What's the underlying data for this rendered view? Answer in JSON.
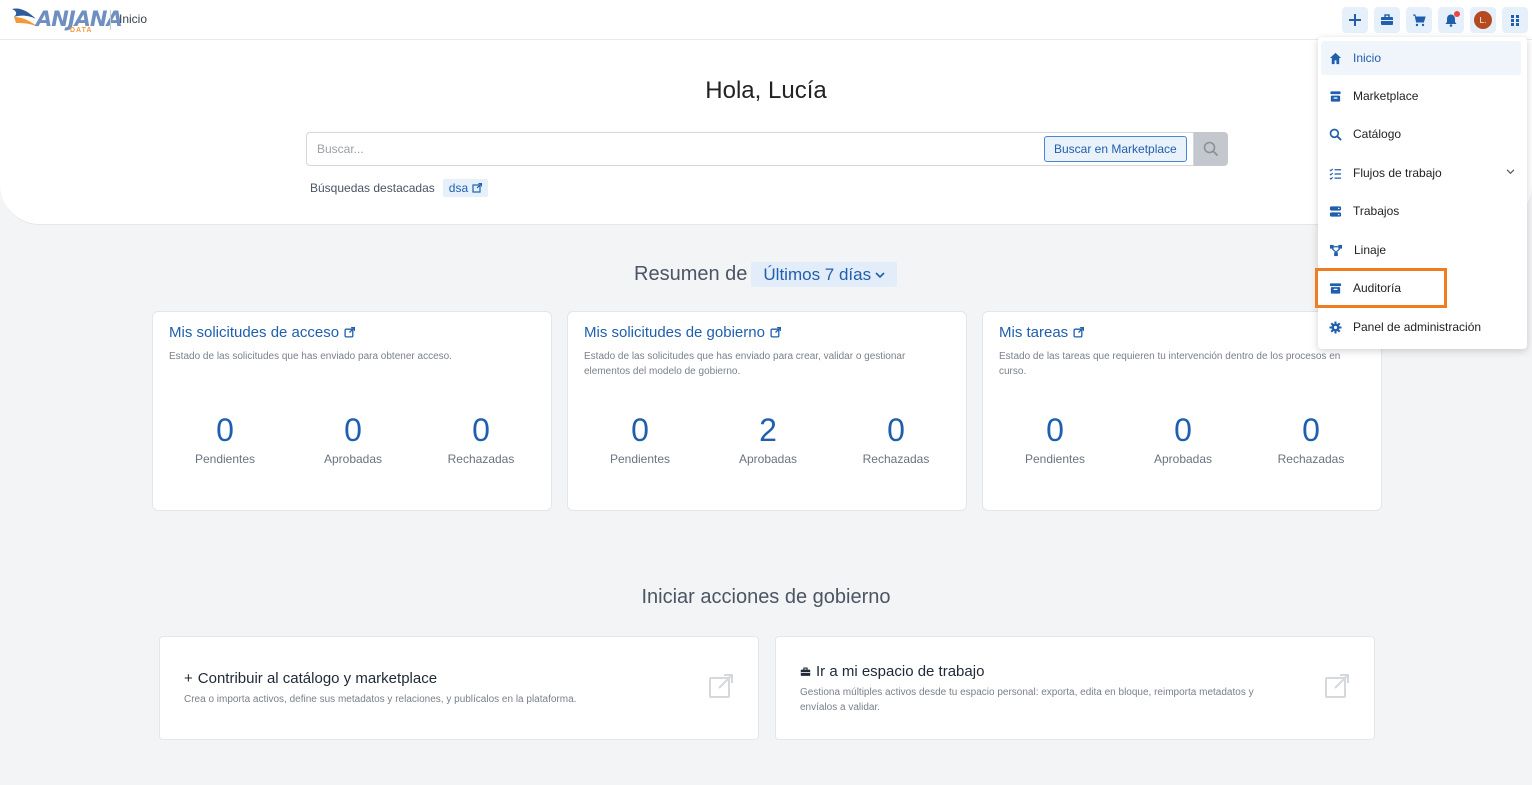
{
  "header": {
    "logo_text": "ANJANA",
    "logo_sub": "DATA",
    "breadcrumb": "Inicio",
    "avatar_initial": "L.",
    "icons": [
      "plus-icon",
      "briefcase-icon",
      "cart-icon",
      "bell-icon",
      "avatar",
      "grid-icon"
    ]
  },
  "hero": {
    "greeting": "Hola, Lucía",
    "search_placeholder": "Buscar...",
    "marketplace_button": "Buscar en Marketplace",
    "featured_label": "Búsquedas destacadas",
    "featured_chip": "dsa"
  },
  "summary": {
    "title": "Resumen de",
    "range": "Últimos 7 días",
    "cards": [
      {
        "title": "Mis solicitudes de acceso",
        "description": "Estado de las solicitudes que has enviado para obtener acceso.",
        "stats": [
          {
            "value": "0",
            "label": "Pendientes"
          },
          {
            "value": "0",
            "label": "Aprobadas"
          },
          {
            "value": "0",
            "label": "Rechazadas"
          }
        ]
      },
      {
        "title": "Mis solicitudes de gobierno",
        "description": "Estado de las solicitudes que has enviado para crear, validar o gestionar elementos del modelo de gobierno.",
        "stats": [
          {
            "value": "0",
            "label": "Pendientes"
          },
          {
            "value": "2",
            "label": "Aprobadas"
          },
          {
            "value": "0",
            "label": "Rechazadas"
          }
        ]
      },
      {
        "title": "Mis tareas",
        "description": "Estado de las tareas que requieren tu intervención dentro de los procesos en curso.",
        "stats": [
          {
            "value": "0",
            "label": "Pendientes"
          },
          {
            "value": "0",
            "label": "Aprobadas"
          },
          {
            "value": "0",
            "label": "Rechazadas"
          }
        ]
      }
    ]
  },
  "governance": {
    "title": "Iniciar acciones de gobierno",
    "actions": [
      {
        "prefix": "+",
        "title": "Contribuir al catálogo y marketplace",
        "description": "Crea o importa activos, define sus metadatos y relaciones, y publícalos en la plataforma."
      },
      {
        "title": "Ir a mi espacio de trabajo",
        "description": "Gestiona múltiples activos desde tu espacio personal: exporta, edita en bloque, reimporta metadatos y envíalos a validar."
      }
    ]
  },
  "menu": {
    "items": [
      {
        "label": "Inicio",
        "icon": "home-icon",
        "active": true
      },
      {
        "label": "Marketplace",
        "icon": "store-icon"
      },
      {
        "label": "Catálogo",
        "icon": "search-icon"
      },
      {
        "label": "Flujos de trabajo",
        "icon": "checklist-icon",
        "expandable": true
      },
      {
        "label": "Trabajos",
        "icon": "server-icon"
      },
      {
        "label": "Linaje",
        "icon": "lineage-icon"
      },
      {
        "label": "Auditoría",
        "icon": "archive-icon",
        "highlighted": true
      },
      {
        "label": "Panel de administración",
        "icon": "gear-icon"
      }
    ]
  },
  "colors": {
    "accent": "#1f5fae",
    "highlight": "#f07d22",
    "background": "#f3f4f6"
  }
}
